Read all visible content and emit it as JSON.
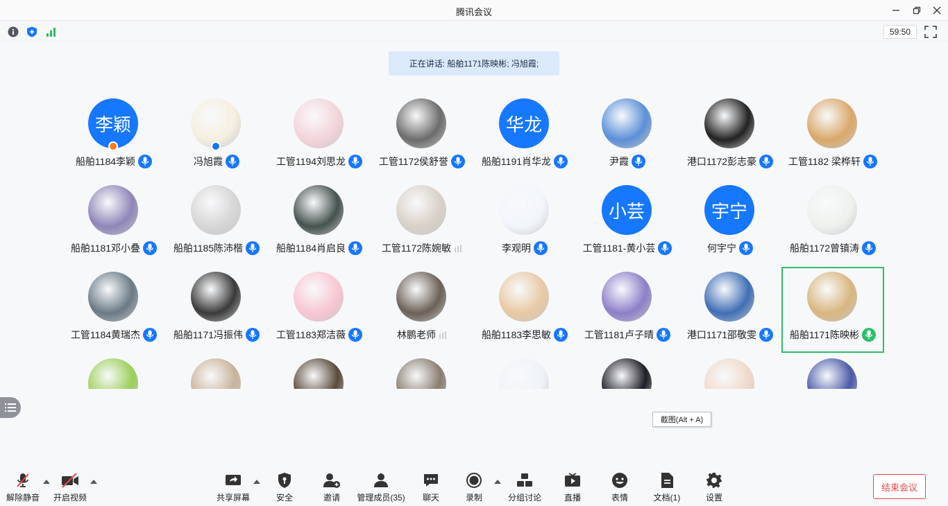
{
  "window": {
    "title": "腾讯会议",
    "minimize_icon": "minimize-icon",
    "restore_icon": "restore-icon",
    "close_icon": "close-icon"
  },
  "info_bar": {
    "timer": "59:50"
  },
  "speaking": "正在讲话: 船舶1171陈映彬; 冯旭霞;",
  "participants": [
    {
      "name": "船舶1184李颖",
      "avatar_text": "李颖",
      "badge": "host",
      "mic": "blue"
    },
    {
      "name": "冯旭霞",
      "avatar_text": "",
      "badge": "cohost",
      "mic": "blue"
    },
    {
      "name": "工管1194刘思龙",
      "avatar_text": "",
      "mic": "blue"
    },
    {
      "name": "工管1172侯舒誉",
      "avatar_text": "",
      "mic": "blue"
    },
    {
      "name": "船舶1191肖华龙",
      "avatar_text": "华龙",
      "mic": "blue"
    },
    {
      "name": "尹霞",
      "avatar_text": "",
      "mic": "blue"
    },
    {
      "name": "港口1172彭志豪",
      "avatar_text": "",
      "mic": "blue"
    },
    {
      "name": "工管1182 梁桦轩",
      "avatar_text": "",
      "mic": "blue"
    },
    {
      "name": "船舶1181邓小叠",
      "avatar_text": "",
      "mic": "blue"
    },
    {
      "name": "船舶1185陈沛楷",
      "avatar_text": "",
      "mic": "blue"
    },
    {
      "name": "船舶1184肖启良",
      "avatar_text": "",
      "mic": "blue"
    },
    {
      "name": "工管1172陈婉敏",
      "avatar_text": "",
      "mic": "none"
    },
    {
      "name": "李观明",
      "avatar_text": "",
      "mic": "blue"
    },
    {
      "name": "工管1181-黄小芸",
      "avatar_text": "小芸",
      "mic": "blue"
    },
    {
      "name": "何宇宁",
      "avatar_text": "宇宁",
      "mic": "blue"
    },
    {
      "name": "船舶1172曾镇涛",
      "avatar_text": "",
      "mic": "blue"
    },
    {
      "name": "工管1184黄瑞杰",
      "avatar_text": "",
      "mic": "blue"
    },
    {
      "name": "船舶1171冯振伟",
      "avatar_text": "",
      "mic": "blue"
    },
    {
      "name": "工管1183郑洁薇",
      "avatar_text": "",
      "mic": "blue"
    },
    {
      "name": "林鹏老师",
      "avatar_text": "",
      "mic": "none"
    },
    {
      "name": "船舶1183李思敏",
      "avatar_text": "",
      "mic": "blue"
    },
    {
      "name": "工管1181卢子晴",
      "avatar_text": "",
      "mic": "blue"
    },
    {
      "name": "港口1171邵敬雯",
      "avatar_text": "",
      "mic": "blue"
    },
    {
      "name": "船舶1171陈映彬",
      "avatar_text": "",
      "mic": "green",
      "active": true
    }
  ],
  "tooltip": "截图(Alt + A)",
  "toolbar": {
    "unmute": "解除静音",
    "start_video": "开启视频",
    "share_screen": "共享屏幕",
    "security": "安全",
    "invite": "邀请",
    "members": "管理成员(35)",
    "chat": "聊天",
    "record": "录制",
    "breakout": "分组讨论",
    "live": "直播",
    "reactions": "表情",
    "docs": "文档(1)",
    "settings": "设置",
    "end": "结束会议"
  },
  "colors": {
    "accent": "#1677ff",
    "active_border": "#2ebd6b",
    "end": "#e64545"
  }
}
